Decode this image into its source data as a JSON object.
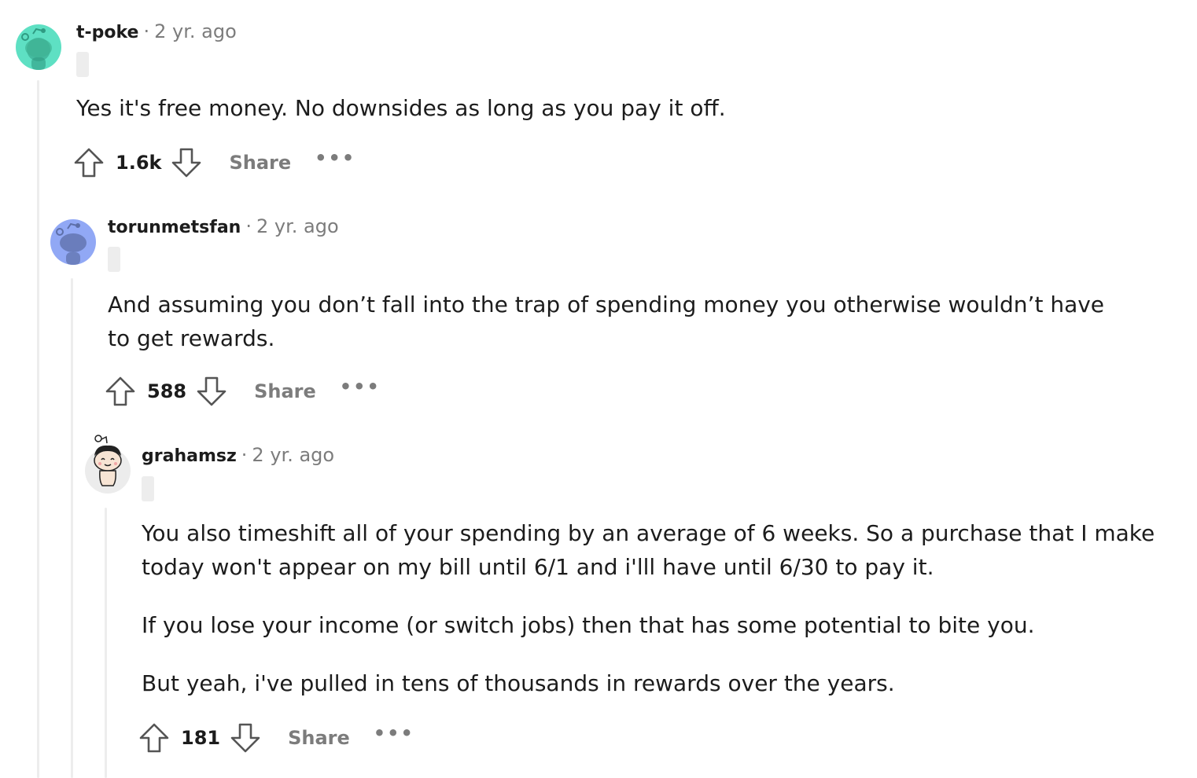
{
  "comments": [
    {
      "author": "t-poke",
      "separator": "·",
      "time": "2 yr. ago",
      "body": [
        "Yes it's free money. No downsides as long as you pay it off."
      ],
      "score": "1.6k",
      "share_label": "Share",
      "more_label": "•••",
      "avatar_color": "#5ee0c3",
      "avatar_icon": "snoo-avatar-icon"
    },
    {
      "author": "torunmetsfan",
      "separator": "·",
      "time": "2 yr. ago",
      "body": [
        "And assuming you don’t fall into the trap of spending money you otherwise wouldn’t have to get rewards."
      ],
      "score": "588",
      "share_label": "Share",
      "more_label": "•••",
      "avatar_color": "#91a8f5",
      "avatar_icon": "snoo-avatar-icon"
    },
    {
      "author": "grahamsz",
      "separator": "·",
      "time": "2 yr. ago",
      "body": [
        "You also timeshift all of your spending by an average of 6 weeks. So a purchase that I make today won't appear on my bill until 6/1 and i'lll have until 6/30 to pay it.",
        "If you lose your income (or switch jobs) then that has some potential to bite you.",
        "But yeah, i've pulled in tens of thousands in rewards over the years."
      ],
      "score": "181",
      "share_label": "Share",
      "more_label": "•••",
      "avatar_color": "#ececec",
      "avatar_icon": "custom-snoo-avatar-icon"
    }
  ]
}
